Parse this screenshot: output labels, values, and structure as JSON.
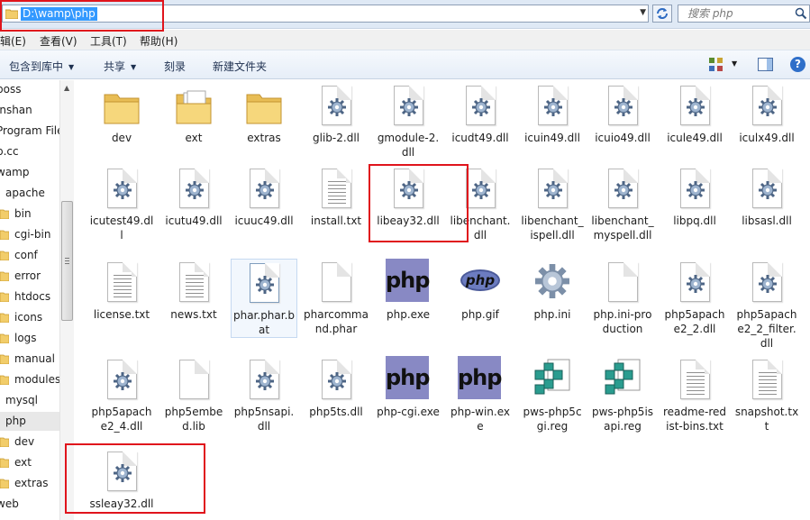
{
  "address": {
    "path": "D:\\wamp\\php"
  },
  "search": {
    "placeholder": "搜索 php"
  },
  "menu": {
    "edit": "编辑(E)",
    "view": "查看(V)",
    "tools": "工具(T)",
    "help": "帮助(H)"
  },
  "toolbar": {
    "include_library": "包含到库中",
    "share": "共享",
    "burn": "刻录",
    "new_folder": "新建文件夹",
    "help_symbol": "?"
  },
  "nav": {
    "items": [
      {
        "label": "boss",
        "indent": 0,
        "folder": false
      },
      {
        "label": "inshan",
        "indent": 0,
        "folder": false
      },
      {
        "label": "Program Files",
        "indent": 0,
        "folder": false
      },
      {
        "label": "p.cc",
        "indent": 0,
        "folder": false
      },
      {
        "label": "wamp",
        "indent": 0,
        "folder": false
      },
      {
        "label": "apache",
        "indent": 1,
        "folder": false
      },
      {
        "label": "bin",
        "indent": 1,
        "folder": true
      },
      {
        "label": "cgi-bin",
        "indent": 1,
        "folder": true
      },
      {
        "label": "conf",
        "indent": 1,
        "folder": true
      },
      {
        "label": "error",
        "indent": 1,
        "folder": true
      },
      {
        "label": "htdocs",
        "indent": 1,
        "folder": true
      },
      {
        "label": "icons",
        "indent": 1,
        "folder": true
      },
      {
        "label": "logs",
        "indent": 1,
        "folder": true
      },
      {
        "label": "manual",
        "indent": 1,
        "folder": true
      },
      {
        "label": "modules",
        "indent": 1,
        "folder": true
      },
      {
        "label": "mysql",
        "indent": 1,
        "folder": false
      },
      {
        "label": "php",
        "indent": 1,
        "folder": false,
        "selected": true
      },
      {
        "label": "dev",
        "indent": 1,
        "folder": true
      },
      {
        "label": "ext",
        "indent": 1,
        "folder": true
      },
      {
        "label": "extras",
        "indent": 1,
        "folder": true
      },
      {
        "label": "web",
        "indent": 0,
        "folder": false
      }
    ]
  },
  "files": [
    {
      "name": "dev",
      "type": "folder"
    },
    {
      "name": "ext",
      "type": "folder-docs"
    },
    {
      "name": "extras",
      "type": "folder"
    },
    {
      "name": "glib-2.dll",
      "type": "dll"
    },
    {
      "name": "gmodule-2.dll",
      "type": "dll"
    },
    {
      "name": "icudt49.dll",
      "type": "dll"
    },
    {
      "name": "icuin49.dll",
      "type": "dll"
    },
    {
      "name": "icuio49.dll",
      "type": "dll"
    },
    {
      "name": "icule49.dll",
      "type": "dll"
    },
    {
      "name": "iculx49.dll",
      "type": "dll"
    },
    {
      "name": "icutest49.dll",
      "type": "dll"
    },
    {
      "name": "icutu49.dll",
      "type": "dll"
    },
    {
      "name": "icuuc49.dll",
      "type": "dll"
    },
    {
      "name": "install.txt",
      "type": "txt"
    },
    {
      "name": "libeay32.dll",
      "type": "dll"
    },
    {
      "name": "libenchant.dll",
      "type": "dll"
    },
    {
      "name": "libenchant_ispell.dll",
      "type": "dll"
    },
    {
      "name": "libenchant_myspell.dll",
      "type": "dll"
    },
    {
      "name": "libpq.dll",
      "type": "dll"
    },
    {
      "name": "libsasl.dll",
      "type": "dll"
    },
    {
      "name": "license.txt",
      "type": "txt"
    },
    {
      "name": "news.txt",
      "type": "txt"
    },
    {
      "name": "phar.phar.bat",
      "type": "bat"
    },
    {
      "name": "pharcommand.phar",
      "type": "blank"
    },
    {
      "name": "php.exe",
      "type": "php"
    },
    {
      "name": "php.gif",
      "type": "phpgif"
    },
    {
      "name": "php.ini",
      "type": "ini"
    },
    {
      "name": "php.ini-production",
      "type": "blank"
    },
    {
      "name": "php5apache2_2.dll",
      "type": "dll"
    },
    {
      "name": "php5apache2_2_filter.dll",
      "type": "dll"
    },
    {
      "name": "php5apache2_4.dll",
      "type": "dll"
    },
    {
      "name": "php5embed.lib",
      "type": "blank"
    },
    {
      "name": "php5nsapi.dll",
      "type": "dll"
    },
    {
      "name": "php5ts.dll",
      "type": "dll"
    },
    {
      "name": "php-cgi.exe",
      "type": "php"
    },
    {
      "name": "php-win.exe",
      "type": "php"
    },
    {
      "name": "pws-php5cgi.reg",
      "type": "reg"
    },
    {
      "name": "pws-php5isapi.reg",
      "type": "reg"
    },
    {
      "name": "readme-redist-bins.txt",
      "type": "txt"
    },
    {
      "name": "snapshot.txt",
      "type": "txt"
    },
    {
      "name": "ssleay32.dll",
      "type": "dll"
    }
  ],
  "colors": {
    "annotation": "#e0141c",
    "selection": "#3399ff",
    "php_icon": "#8889c4",
    "folder": "#f2cd6a"
  }
}
